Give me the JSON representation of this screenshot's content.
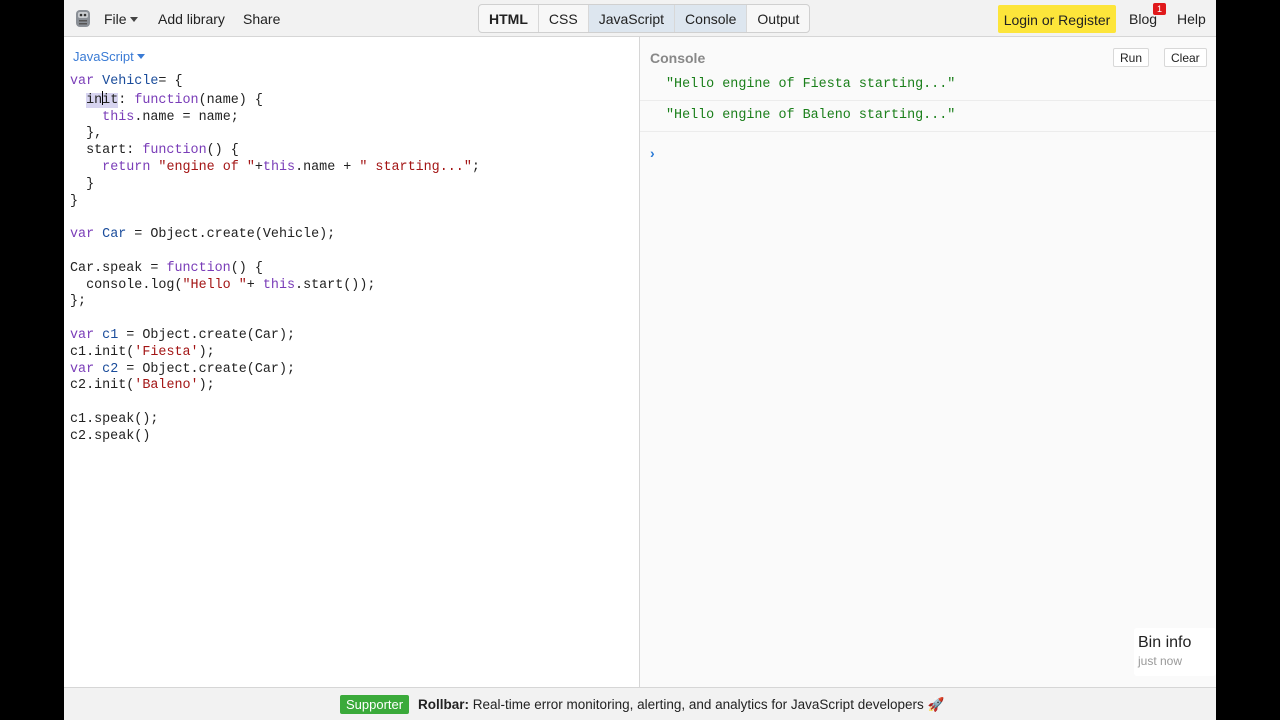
{
  "topbar": {
    "menus": [
      "File",
      "Add library",
      "Share"
    ],
    "panels": [
      {
        "label": "HTML",
        "bold": true,
        "active": false
      },
      {
        "label": "CSS",
        "bold": false,
        "active": false
      },
      {
        "label": "JavaScript",
        "bold": false,
        "active": true
      },
      {
        "label": "Console",
        "bold": false,
        "active": true
      },
      {
        "label": "Output",
        "bold": false,
        "active": false
      }
    ],
    "login_label": "Login or Register",
    "blog_label": "Blog",
    "blog_badge": "1",
    "help_label": "Help"
  },
  "editor": {
    "language": "JavaScript",
    "code_lines": [
      "var Vehicle= {",
      "  init: function(name) {",
      "    this.name = name;",
      "  },",
      "  start: function() {",
      "    return \"engine of \"+this.name + \" starting...\";",
      "  }",
      "}",
      "",
      "var Car = Object.create(Vehicle);",
      "",
      "Car.speak = function() {",
      "  console.log(\"Hello \"+ this.start());",
      "};",
      "",
      "var c1 = Object.create(Car);",
      "c1.init('Fiesta');",
      "var c2 = Object.create(Car);",
      "c2.init('Baleno');",
      "",
      "c1.speak();",
      "c2.speak()"
    ]
  },
  "console": {
    "title": "Console",
    "run_label": "Run",
    "clear_label": "Clear",
    "logs": [
      "\"Hello engine of Fiesta starting...\"",
      "\"Hello engine of Baleno starting...\""
    ],
    "prompt_symbol": "›"
  },
  "bin_info": {
    "title": "Bin info",
    "time": "just now"
  },
  "footer": {
    "badge": "Supporter",
    "sponsor": "Rollbar:",
    "message": "Real-time error monitoring, alerting, and analytics for JavaScript developers",
    "emoji": "🚀"
  },
  "colors": {
    "accent_blue": "#3a7bd5",
    "login_yellow": "#fde53a",
    "supporter_green": "#3aaa3a",
    "console_green": "#1a7f1a"
  }
}
